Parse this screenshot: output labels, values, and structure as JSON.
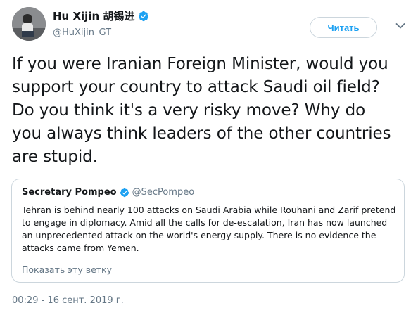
{
  "author": {
    "display_name": "Hu Xijin 胡锡进",
    "handle": "@HuXijin_GT"
  },
  "follow_button_label": "Читать",
  "tweet": {
    "text": "If you were Iranian Foreign Minister, would you support your country to attack Saudi oil field? Do you think it's a very risky move? Why do you always think leaders of the other countries are stupid."
  },
  "quoted": {
    "display_name": "Secretary Pompeo",
    "handle": "@SecPompeo",
    "text": "Tehran is behind nearly 100 attacks on Saudi Arabia while Rouhani and Zarif pretend to engage in diplomacy. Amid all the calls for de-escalation, Iran has now launched an unprecedented attack on the world's energy supply.  There is no evidence the attacks came from Yemen.",
    "show_thread_label": "Показать эту ветку"
  },
  "timestamp": "00:29 - 16 сент. 2019 г.",
  "colors": {
    "accent": "#1da1f2",
    "secondary_text": "#657786",
    "border": "#ccd6dd"
  },
  "icons": {
    "verified": "verified-badge-icon",
    "more": "chevron-down-icon"
  }
}
